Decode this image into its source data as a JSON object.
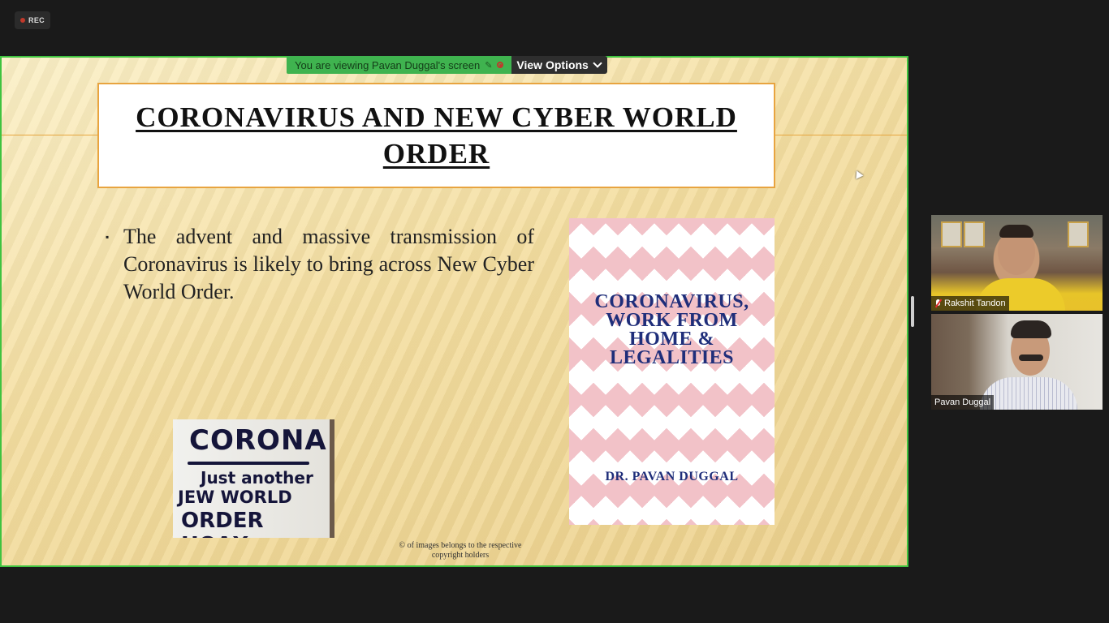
{
  "recording": {
    "label": "REC"
  },
  "banner": {
    "viewing_text": "You are viewing Pavan Duggal's screen",
    "view_options_label": "View Options"
  },
  "slide": {
    "title": "CORONAVIRUS AND NEW CYBER WORLD ORDER",
    "bullet": "The advent and massive transmission of Coronavirus is likely to bring across New Cyber World Order.",
    "bullet_marker": "▪",
    "sign_image": {
      "line1": "CORONA",
      "line2": "Just another",
      "line3": "JEW WORLD",
      "line4": "ORDER HOAX"
    },
    "book_cover": {
      "title_lines": [
        "CORONAVIRUS,",
        "WORK FROM",
        "HOME &",
        "LEGALITIES"
      ],
      "author": "DR. PAVAN DUGGAL"
    },
    "copyright": "© of images belongs to the respective copyright holders"
  },
  "participants": [
    {
      "name": "Rakshit Tandon",
      "muted": true
    },
    {
      "name": "Pavan Duggal",
      "muted": false
    }
  ],
  "colors": {
    "share_border": "#3fc33f",
    "banner_green": "#3fb34f",
    "title_border": "#e8a440",
    "book_text": "#1f2e7a",
    "book_pattern": "#f2c2c8"
  }
}
